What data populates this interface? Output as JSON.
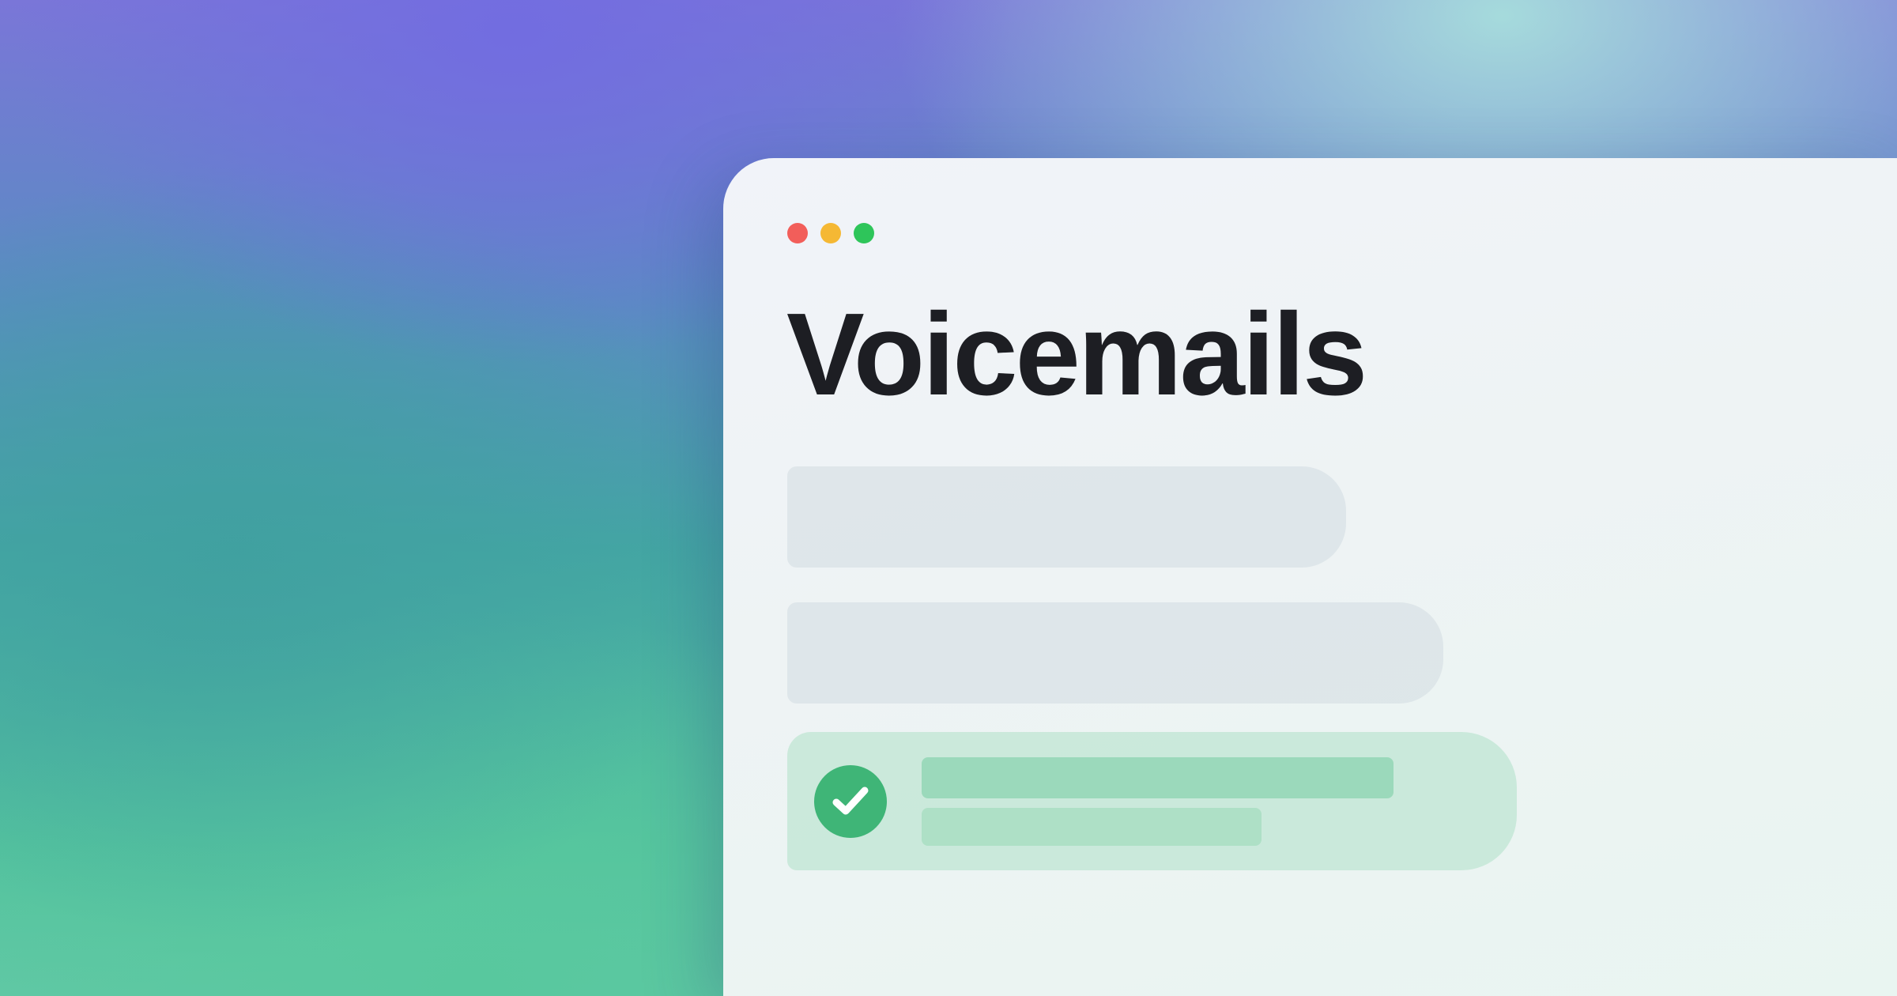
{
  "window": {
    "title": "Voicemails",
    "traffic_lights": [
      {
        "name": "close",
        "color": "#f25e5a"
      },
      {
        "name": "minimize",
        "color": "#f5b834"
      },
      {
        "name": "maximize",
        "color": "#2ec55a"
      }
    ]
  },
  "list": {
    "rows": [
      {
        "state": "placeholder"
      },
      {
        "state": "placeholder"
      },
      {
        "state": "confirmed",
        "icon": "check-circle-icon",
        "icon_color": "#3fb577"
      }
    ]
  }
}
